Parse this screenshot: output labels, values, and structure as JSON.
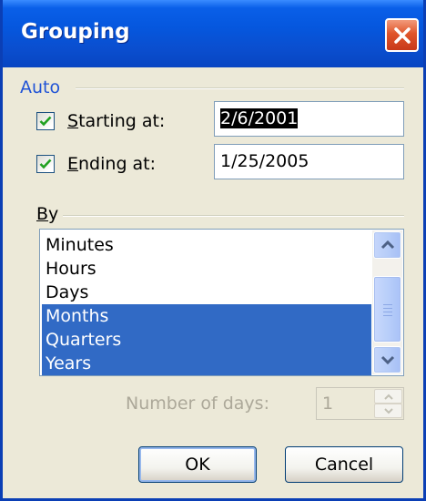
{
  "window": {
    "title": "Grouping"
  },
  "auto_group": {
    "label": "Auto",
    "starting": {
      "checked": true,
      "label_prefix": "S",
      "label_rest": "tarting at:",
      "value": "2/6/2001"
    },
    "ending": {
      "checked": true,
      "label_prefix": "E",
      "label_rest": "nding at:",
      "value": "1/25/2005"
    }
  },
  "by_group": {
    "label_prefix": "B",
    "label_rest": "y",
    "items": [
      {
        "label": "Minutes",
        "selected": false
      },
      {
        "label": "Hours",
        "selected": false
      },
      {
        "label": "Days",
        "selected": false
      },
      {
        "label": "Months",
        "selected": true
      },
      {
        "label": "Quarters",
        "selected": true
      },
      {
        "label": "Years",
        "selected": true
      }
    ]
  },
  "number_of_days": {
    "label": "Number of days:",
    "value": "1"
  },
  "buttons": {
    "ok": "OK",
    "cancel": "Cancel"
  },
  "colors": {
    "title_bar": "#0557de",
    "selection": "#316ac5",
    "group_label": "#2053d6",
    "disabled_text": "#aca899"
  },
  "icons": {
    "close": "close-icon",
    "check": "checkmark-icon",
    "scroll_up": "chevron-up-icon",
    "scroll_down": "chevron-down-icon"
  }
}
